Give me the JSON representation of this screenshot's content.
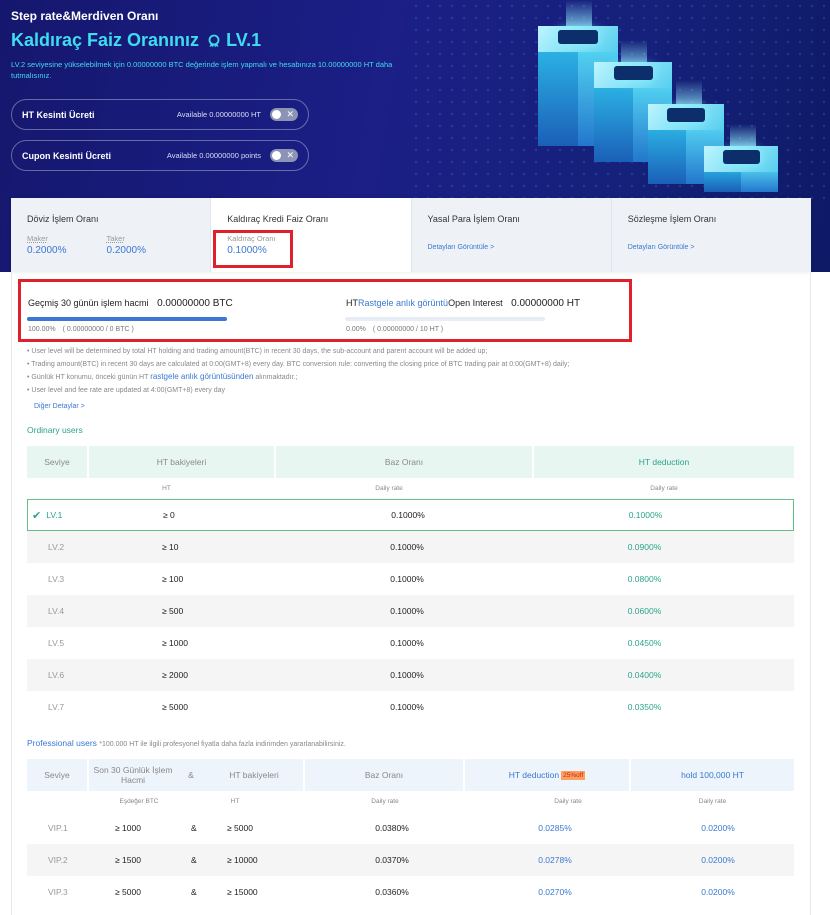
{
  "hero": {
    "subtitle": "Step rate&Merdiven Oranı",
    "title": "Kaldıraç Faiz Oranınız",
    "level": "LV.1",
    "description": "LV.2 seviyesine yükselebilmek için 0.00000000 BTC değerinde işlem yapmalı ve hesabınıza 10.00000000 HT daha tutmalısınız.",
    "toggles": [
      {
        "label": "HT Kesinti Ücreti",
        "available": "Available 0.00000000 HT",
        "on": false
      },
      {
        "label": "Cupon Kesinti Ücreti",
        "available": "Available 0.00000000 points",
        "on": false
      }
    ],
    "colors": {
      "accent": "#3fdcf0",
      "bg": "#1b1f86"
    }
  },
  "tabs": [
    {
      "name": "Döviz İşlem Oranı",
      "maker_label": "Maker",
      "maker_value": "0.2000%",
      "taker_label": "Taker",
      "taker_value": "0.2000%"
    },
    {
      "name": "Kaldıraç Kredi Faiz Oranı",
      "rate_label": "Kaldıraç Oranı",
      "rate_value": "0.1000%"
    },
    {
      "name": "Yasal Para İşlem Oranı",
      "link": "Detayları Görüntüle >"
    },
    {
      "name": "Sözleşme İşlem Oranı",
      "link": "Detayları Görüntüle >"
    }
  ],
  "progress": {
    "left_label": "Geçmiş 30 günün işlem hacmi",
    "left_value": "0.00000000 BTC",
    "left_percent": "100.00%",
    "left_detail": "( 0.00000000 / 0 BTC )",
    "left_fraction": 1.0,
    "right_label_prefix": "HT",
    "right_label_link": "Rastgele anlık görüntü",
    "right_label_suffix": "Open Interest",
    "right_value": "0.00000000 HT",
    "right_percent": "0.00%",
    "right_detail": "( 0.00000000 / 10 HT )",
    "right_fraction": 0.0
  },
  "notes": [
    "User level will be determined by total HT holding and trading amount(BTC) in recent 30 days, the sub-account and parent account will be added up;",
    "Trading amount(BTC) in recent 30 days are calculated at 0:00(GMT+8) every day. BTC conversion rule: converting the closing price of BTC trading pair at 0:00(GMT+8) daily;",
    "Günlük HT konumu, önceki günün HT ",
    "rastgele anlık görüntüsünden",
    " alınmaktadır.;",
    "User level and fee rate are updated at 4:00(GMT+8) every day"
  ],
  "more_link": "Diğer Detaylar >",
  "ordinary": {
    "title": "Ordinary users",
    "headers": [
      "Seviye",
      "HT bakiyeleri",
      "Baz Oranı",
      "HT deduction"
    ],
    "subheaders": [
      "",
      "HT",
      "Daily rate",
      "Daily rate"
    ],
    "rows": [
      {
        "level": "LV.1",
        "ht": "≥ 0",
        "base": "0.1000%",
        "deduction": "0.1000%",
        "current": true
      },
      {
        "level": "LV.2",
        "ht": "≥ 10",
        "base": "0.1000%",
        "deduction": "0.0900%"
      },
      {
        "level": "LV.3",
        "ht": "≥ 100",
        "base": "0.1000%",
        "deduction": "0.0800%"
      },
      {
        "level": "LV.4",
        "ht": "≥ 500",
        "base": "0.1000%",
        "deduction": "0.0600%"
      },
      {
        "level": "LV.5",
        "ht": "≥ 1000",
        "base": "0.1000%",
        "deduction": "0.0450%"
      },
      {
        "level": "LV.6",
        "ht": "≥ 2000",
        "base": "0.1000%",
        "deduction": "0.0400%"
      },
      {
        "level": "LV.7",
        "ht": "≥ 5000",
        "base": "0.1000%",
        "deduction": "0.0350%"
      }
    ]
  },
  "professional": {
    "title": "Professional users",
    "note": "*100.000 HT ile ilgili profesyonel fiyatla daha fazla indirimden yararlanabilirsiniz.",
    "headers": [
      "Seviye",
      "Son 30 Günlük İşlem Hacmi",
      "&",
      "HT bakiyeleri",
      "Baz Oranı",
      "HT deduction",
      "25%off",
      "hold 100,000 HT"
    ],
    "subheaders": [
      "",
      "Eşdeğer BTC",
      "",
      "HT",
      "Daily rate",
      "Daily rate",
      "Daily rate"
    ],
    "rows": [
      {
        "level": "VIP.1",
        "volume": "≥ 1000",
        "amp": "&",
        "ht": "≥ 5000",
        "base": "0.0380%",
        "deduction": "0.0285%",
        "hold": "0.0200%"
      },
      {
        "level": "VIP.2",
        "volume": "≥ 1500",
        "amp": "&",
        "ht": "≥ 10000",
        "base": "0.0370%",
        "deduction": "0.0278%",
        "hold": "0.0200%"
      },
      {
        "level": "VIP.3",
        "volume": "≥ 5000",
        "amp": "&",
        "ht": "≥ 15000",
        "base": "0.0360%",
        "deduction": "0.0270%",
        "hold": "0.0200%"
      }
    ]
  }
}
